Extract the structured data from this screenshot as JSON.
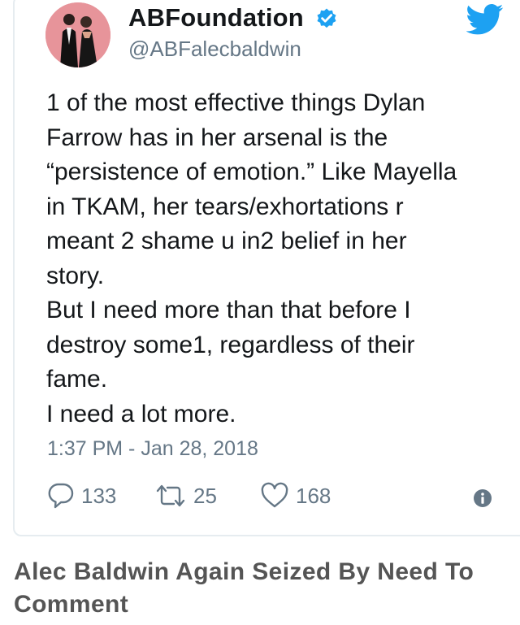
{
  "tweet": {
    "display_name": "ABFoundation",
    "handle": "@ABFalecbaldwin",
    "text_lines": [
      "1 of the most effective things Dylan",
      "Farrow has in her arsenal is the",
      "“persistence of emotion.” Like Mayella",
      "in TKAM, her tears/exhortations r",
      "meant 2 shame u in2 belief in her",
      "story.",
      "But I need more than that before I",
      "destroy some1, regardless of their",
      "fame.",
      "I need a lot more."
    ],
    "timestamp": "1:37 PM - Jan 28, 2018",
    "actions": {
      "replies": "133",
      "retweets": "25",
      "likes": "168"
    },
    "icons": {
      "verified": "verified-badge-icon",
      "brand": "twitter-bird-icon",
      "reply": "reply-icon",
      "retweet": "retweet-icon",
      "like": "heart-icon",
      "info": "info-icon"
    },
    "colors": {
      "twitter_blue": "#1da1f2",
      "name": "#14171a",
      "muted": "#657786",
      "avatar_bg": "#e7949a"
    }
  },
  "article": {
    "headline": "Alec Baldwin Again Seized By Need To Comment"
  }
}
